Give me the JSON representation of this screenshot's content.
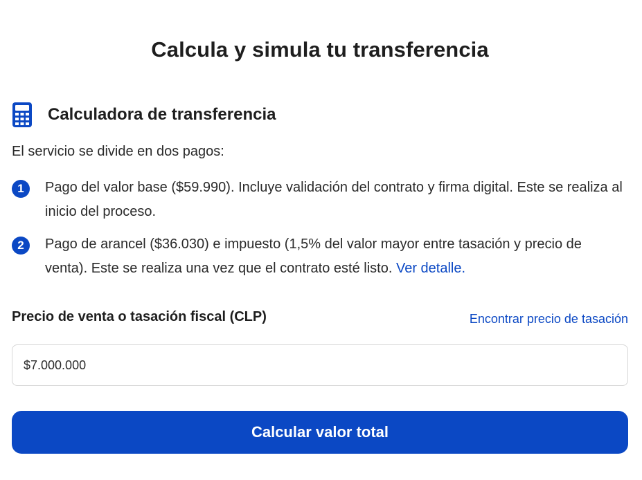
{
  "page": {
    "title": "Calcula y simula tu transferencia"
  },
  "calculator": {
    "icon": "calculator-icon",
    "title": "Calculadora de transferencia",
    "intro": "El servicio se divide en dos pagos:",
    "steps": [
      {
        "number": "1",
        "text": "Pago del valor base ($59.990). Incluye validación del contrato y firma digital. Este se realiza al inicio del proceso."
      },
      {
        "number": "2",
        "text": "Pago de arancel ($36.030) e impuesto (1,5% del valor mayor entre tasación y precio de venta). Este se realiza una vez que el contrato esté listo.",
        "link_label": "Ver detalle."
      }
    ]
  },
  "form": {
    "price_label": "Precio de venta o tasación fiscal (CLP)",
    "find_price_link": "Encontrar precio de tasación",
    "price_value": "$7.000.000",
    "submit_label": "Calcular valor total"
  },
  "colors": {
    "accent": "#0b48c4",
    "text": "#1e1e1e",
    "border": "#d6d6d6"
  }
}
